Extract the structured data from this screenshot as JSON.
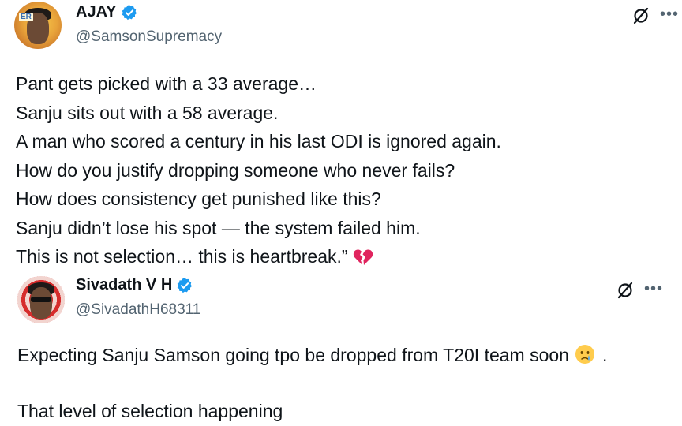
{
  "tweets": [
    {
      "author_name": "AJAY",
      "handle": "@SamsonSupremacy",
      "avatar_tag": "ER",
      "lines": [
        "Pant gets picked with a 33 average…",
        "Sanju sits out with a 58 average.",
        "A man who scored a century in his last ODI is ignored again.",
        "How do you justify dropping someone who never fails?",
        "How does consistency get punished like this?",
        "Sanju didn’t lose his spot — the system failed him.",
        "This is not selection… this is heartbreak.”"
      ],
      "trailing_emoji": "broken-heart-icon"
    },
    {
      "author_name": "Sivadath V H",
      "handle": "@SivadathH68311",
      "line1": "Expecting Sanju Samson going tpo be dropped from T20I team soon",
      "line1_suffix": ".",
      "line2": "That level of selection happening",
      "trailing_emoji": "crying-face-icon"
    }
  ],
  "icons": {
    "verified": "verified-badge-icon",
    "grok": "grok-icon",
    "more": "more-icon"
  },
  "colors": {
    "verified": "#1d9bf0",
    "text": "#0f1419",
    "secondary": "#536471",
    "broken_heart": "#e0245e"
  }
}
